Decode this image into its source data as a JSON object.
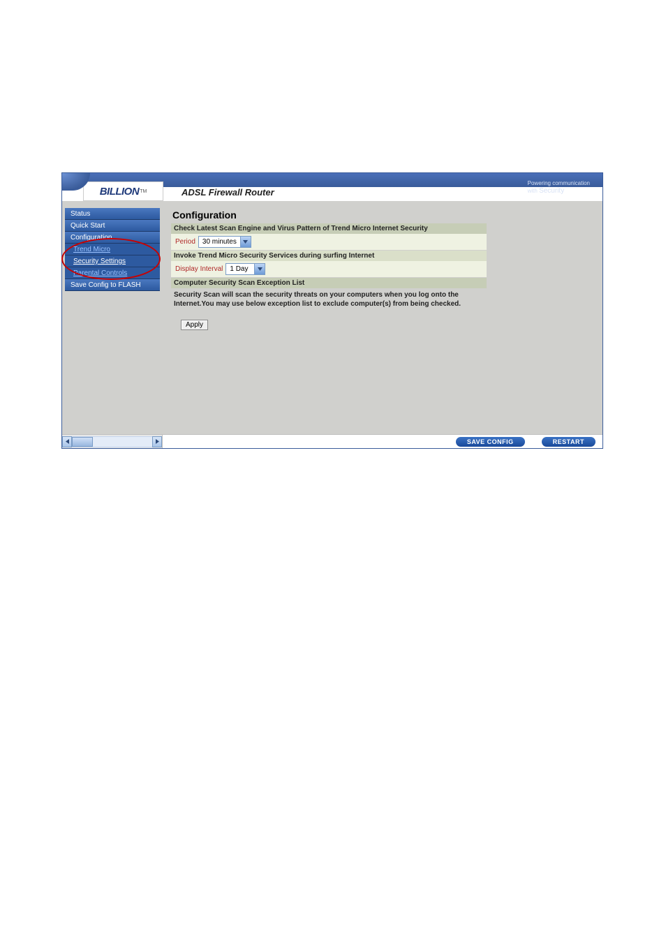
{
  "header": {
    "logo_text": "BILLION",
    "logo_tm": "TM",
    "product_title": "ADSL Firewall Router",
    "tagline_line1": "Powering communication",
    "tagline_line2_prefix": "with ",
    "tagline_line2_main": "Security"
  },
  "sidebar": {
    "items": [
      {
        "label": "Status",
        "type": "main"
      },
      {
        "label": "Quick Start",
        "type": "main"
      },
      {
        "label": "Configuration",
        "type": "main"
      },
      {
        "label": "Trend Micro",
        "type": "sub"
      },
      {
        "label": "Security Settings",
        "type": "sub",
        "selected": true
      },
      {
        "label": "Parental Controls",
        "type": "sub"
      },
      {
        "label": "Save Config to FLASH",
        "type": "main"
      }
    ]
  },
  "content": {
    "panel_title": "Configuration",
    "strip1": "Check Latest Scan Engine and Virus Pattern of Trend Micro Internet Security",
    "period_label": "Period",
    "period_value": "30 minutes",
    "strip2": "Invoke Trend Micro Security Services during surfing Internet",
    "display_interval_label": "Display Interval",
    "display_interval_value": "1 Day",
    "strip3": "Computer Security Scan Exception List",
    "desc": "Security Scan will scan the security threats on your computers when you log onto the Internet.You may use below exception list to exclude computer(s) from being checked.",
    "apply_label": "Apply"
  },
  "footer": {
    "save_config_label": "SAVE CONFIG",
    "restart_label": "RESTART"
  }
}
